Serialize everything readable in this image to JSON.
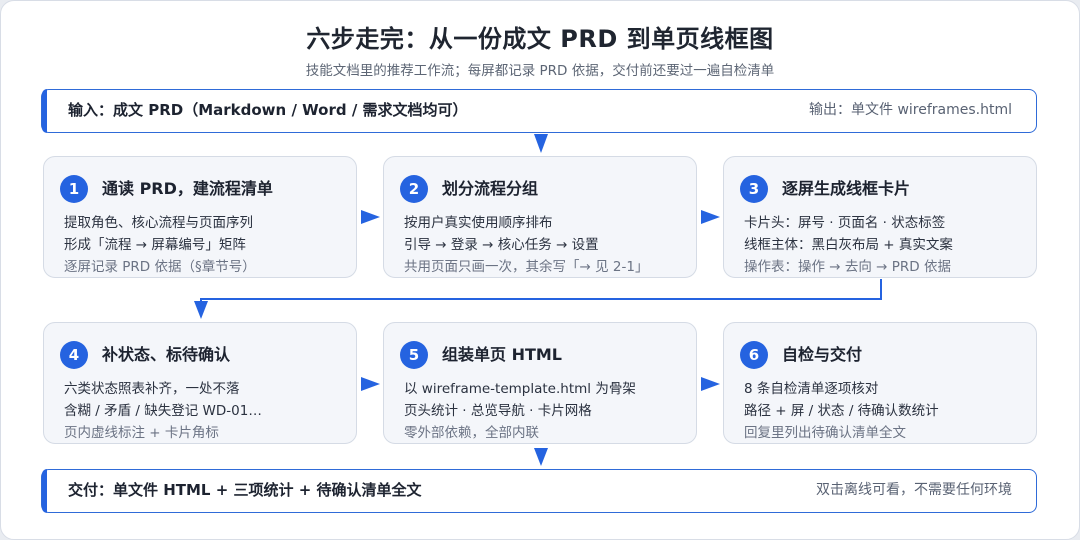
{
  "header": {
    "title": "六步走完：从一份成文 PRD 到单页线框图",
    "subtitle": "技能文档里的推荐工作流；每屏都记录 PRD 依据，交付前还要过一遍自检清单"
  },
  "input_bar": {
    "main": "输入：成文 PRD（Markdown / Word / 需求文档均可）",
    "side": "输出：单文件 wireframes.html"
  },
  "steps": [
    {
      "number": "1",
      "title": "通读 PRD，建流程清单",
      "lines": [
        "提取角色、核心流程与页面序列",
        "形成「流程 → 屏幕编号」矩阵",
        "逐屏记录 PRD 依据（§章节号）"
      ]
    },
    {
      "number": "2",
      "title": "划分流程分组",
      "lines": [
        "按用户真实使用顺序排布",
        "引导 → 登录 → 核心任务 → 设置",
        "共用页面只画一次，其余写「→ 见 2-1」"
      ]
    },
    {
      "number": "3",
      "title": "逐屏生成线框卡片",
      "lines": [
        "卡片头：屏号 · 页面名 · 状态标签",
        "线框主体：黑白灰布局 + 真实文案",
        "操作表：操作 → 去向 → PRD 依据"
      ]
    },
    {
      "number": "4",
      "title": "补状态、标待确认",
      "lines": [
        "六类状态照表补齐，一处不落",
        "含糊 / 矛盾 / 缺失登记 WD-01…",
        "页内虚线标注 + 卡片角标"
      ]
    },
    {
      "number": "5",
      "title": "组装单页 HTML",
      "lines": [
        "以 wireframe-template.html 为骨架",
        "页头统计 · 总览导航 · 卡片网格",
        "零外部依赖，全部内联"
      ]
    },
    {
      "number": "6",
      "title": "自检与交付",
      "lines": [
        "8 条自检清单逐项核对",
        "路径 + 屏 / 状态 / 待确认数统计",
        "回复里列出待确认清单全文"
      ]
    }
  ],
  "output_bar": {
    "main": "交付：单文件 HTML + 三项统计 + 待确认清单全文",
    "side": "双击离线可看，不需要任何环境"
  },
  "colors": {
    "accent": "#2563e0",
    "card_bg": "#f4f6fa",
    "card_border": "#d5dbe5",
    "text": "#1d2330",
    "muted": "#6b7384"
  }
}
